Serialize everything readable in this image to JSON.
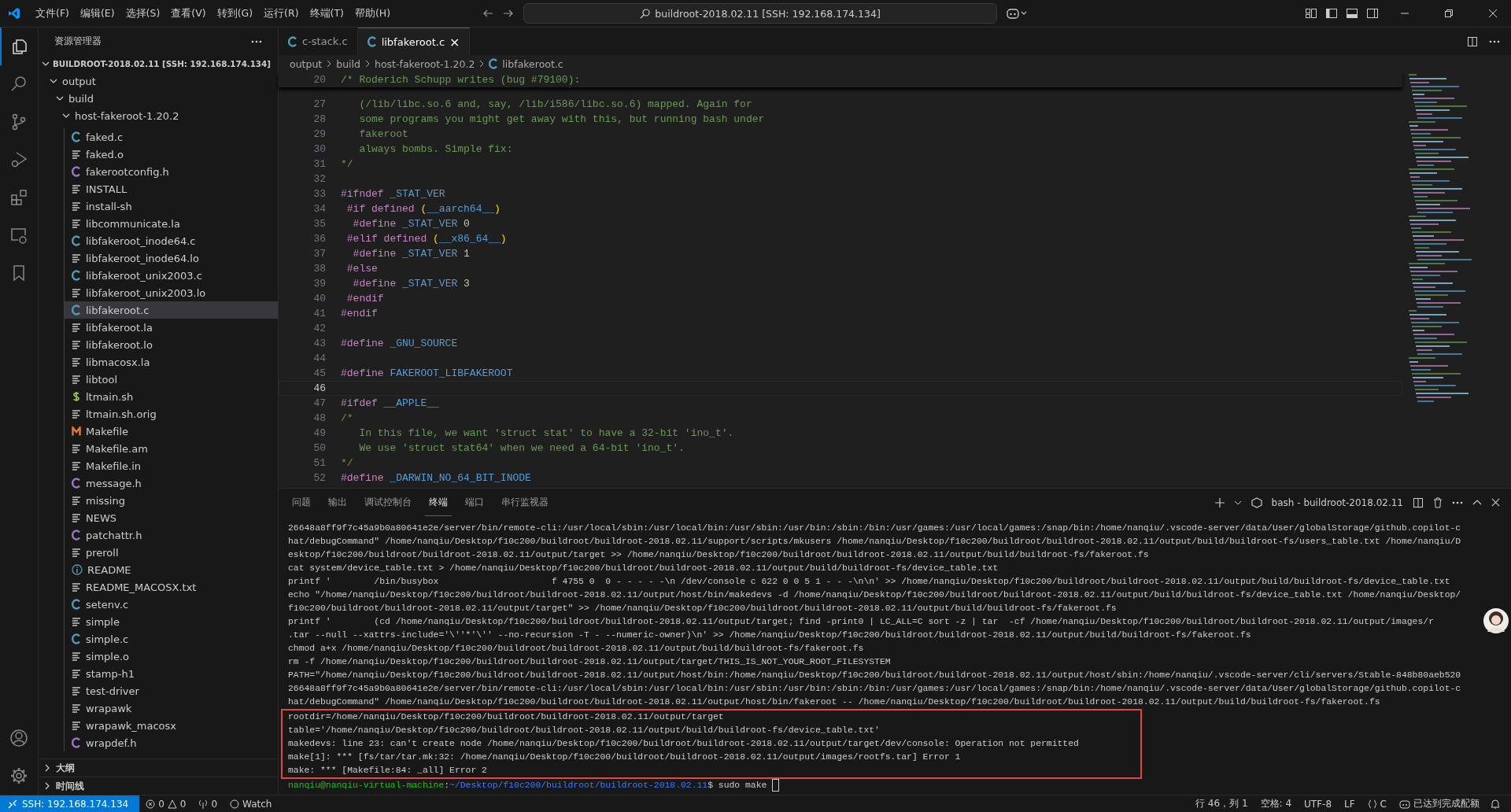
{
  "title_bar": {
    "menus": [
      "文件(F)",
      "编辑(E)",
      "选择(S)",
      "查看(V)",
      "转到(G)",
      "运行(R)",
      "终端(T)",
      "帮助(H)"
    ],
    "command_center": "buildroot-2018.02.11 [SSH: 192.168.174.134]"
  },
  "sidebar": {
    "title": "资源管理器",
    "root": "BUILDROOT-2018.02.11 [SSH: 192.168.174.134]",
    "folders": [
      {
        "label": "output",
        "expanded": true
      },
      {
        "label": "build",
        "expanded": true
      },
      {
        "label": "host-fakeroot-1.20.2",
        "expanded": true
      }
    ],
    "files": [
      {
        "name": "faked.c",
        "kind": "c",
        "selected": false
      },
      {
        "name": "faked.o",
        "kind": "text",
        "selected": false
      },
      {
        "name": "fakerootconfig.h",
        "kind": "h",
        "selected": false
      },
      {
        "name": "INSTALL",
        "kind": "text",
        "selected": false
      },
      {
        "name": "install-sh",
        "kind": "text",
        "selected": false
      },
      {
        "name": "libcommunicate.la",
        "kind": "text",
        "selected": false
      },
      {
        "name": "libfakeroot_inode64.c",
        "kind": "c",
        "selected": false
      },
      {
        "name": "libfakeroot_inode64.lo",
        "kind": "text",
        "selected": false
      },
      {
        "name": "libfakeroot_unix2003.c",
        "kind": "c",
        "selected": false
      },
      {
        "name": "libfakeroot_unix2003.lo",
        "kind": "text",
        "selected": false
      },
      {
        "name": "libfakeroot.c",
        "kind": "c",
        "selected": true
      },
      {
        "name": "libfakeroot.la",
        "kind": "text",
        "selected": false
      },
      {
        "name": "libfakeroot.lo",
        "kind": "text",
        "selected": false
      },
      {
        "name": "libmacosx.la",
        "kind": "text",
        "selected": false
      },
      {
        "name": "libtool",
        "kind": "text",
        "selected": false
      },
      {
        "name": "ltmain.sh",
        "kind": "shell",
        "selected": false
      },
      {
        "name": "ltmain.sh.orig",
        "kind": "text",
        "selected": false
      },
      {
        "name": "Makefile",
        "kind": "make",
        "selected": false
      },
      {
        "name": "Makefile.am",
        "kind": "text",
        "selected": false
      },
      {
        "name": "Makefile.in",
        "kind": "text",
        "selected": false
      },
      {
        "name": "message.h",
        "kind": "h",
        "selected": false
      },
      {
        "name": "missing",
        "kind": "text",
        "selected": false
      },
      {
        "name": "NEWS",
        "kind": "text",
        "selected": false
      },
      {
        "name": "patchattr.h",
        "kind": "h",
        "selected": false
      },
      {
        "name": "preroll",
        "kind": "text",
        "selected": false
      },
      {
        "name": "README",
        "kind": "info",
        "selected": false
      },
      {
        "name": "README_MACOSX.txt",
        "kind": "text",
        "selected": false
      },
      {
        "name": "setenv.c",
        "kind": "c",
        "selected": false
      },
      {
        "name": "simple",
        "kind": "text",
        "selected": false
      },
      {
        "name": "simple.c",
        "kind": "c",
        "selected": false
      },
      {
        "name": "simple.o",
        "kind": "text",
        "selected": false
      },
      {
        "name": "stamp-h1",
        "kind": "text",
        "selected": false
      },
      {
        "name": "test-driver",
        "kind": "text",
        "selected": false
      },
      {
        "name": "wrapawk",
        "kind": "text",
        "selected": false
      },
      {
        "name": "wrapawk_macosx",
        "kind": "text",
        "selected": false
      },
      {
        "name": "wrapdef.h",
        "kind": "h",
        "selected": false
      }
    ],
    "sections": [
      {
        "label": "大纲",
        "expanded": false
      },
      {
        "label": "时间线",
        "expanded": false
      }
    ]
  },
  "tabs": [
    {
      "label": "c-stack.c",
      "kind": "c",
      "selected": false
    },
    {
      "label": "libfakeroot.c",
      "kind": "c",
      "selected": true
    }
  ],
  "close_glyph": "×",
  "breadcrumbs": [
    {
      "label": "output",
      "kind": "folder"
    },
    {
      "label": "build",
      "kind": "folder"
    },
    {
      "label": "host-fakeroot-1.20.2",
      "kind": "folder"
    },
    {
      "label": "libfakeroot.c",
      "kind": "c"
    }
  ],
  "sticky_line": {
    "num": "20",
    "tokens": [
      {
        "kind": "comment",
        "text": "/* Roderich Schupp writes (bug #79100):"
      }
    ]
  },
  "code": [
    {
      "num": "27",
      "current": false,
      "tokens": [
        {
          "kind": "comment",
          "text": "   (/lib/libc.so.6 and, say, /lib/i586/libc.so.6) mapped. Again for"
        }
      ]
    },
    {
      "num": "28",
      "current": false,
      "tokens": [
        {
          "kind": "comment",
          "text": "   some programs you might get away with this, but running bash under"
        }
      ]
    },
    {
      "num": "29",
      "current": false,
      "tokens": [
        {
          "kind": "comment",
          "text": "   fakeroot"
        }
      ]
    },
    {
      "num": "30",
      "current": false,
      "tokens": [
        {
          "kind": "comment",
          "text": "   always bombs. Simple fix:"
        }
      ]
    },
    {
      "num": "31",
      "current": false,
      "tokens": [
        {
          "kind": "comment",
          "text": "*/"
        }
      ]
    },
    {
      "num": "32",
      "current": false
    },
    {
      "num": "33",
      "current": false,
      "tokens": [
        {
          "kind": "directive",
          "text": "#ifndef"
        },
        {
          "kind": "macro",
          "text": " _STAT_VER"
        }
      ]
    },
    {
      "num": "34",
      "current": false,
      "tokens": [
        {
          "kind": "directive",
          "text": " #if defined "
        },
        {
          "kind": "paren",
          "text": "("
        },
        {
          "kind": "macro",
          "text": "__aarch64__"
        },
        {
          "kind": "paren",
          "text": ")"
        }
      ]
    },
    {
      "num": "35",
      "current": false,
      "tokens": [
        {
          "kind": "directive",
          "text": "  #define"
        },
        {
          "kind": "macro",
          "text": " _STAT_VER"
        },
        {
          "kind": "number",
          "text": " 0"
        }
      ]
    },
    {
      "num": "36",
      "current": false,
      "tokens": [
        {
          "kind": "directive",
          "text": " #elif defined "
        },
        {
          "kind": "paren",
          "text": "("
        },
        {
          "kind": "macro",
          "text": "__x86_64__"
        },
        {
          "kind": "paren",
          "text": ")"
        }
      ]
    },
    {
      "num": "37",
      "current": false,
      "tokens": [
        {
          "kind": "directive",
          "text": "  #define"
        },
        {
          "kind": "macro",
          "text": " _STAT_VER"
        },
        {
          "kind": "number",
          "text": " 1"
        }
      ]
    },
    {
      "num": "38",
      "current": false,
      "tokens": [
        {
          "kind": "directive",
          "text": " #else"
        }
      ]
    },
    {
      "num": "39",
      "current": false,
      "tokens": [
        {
          "kind": "directive",
          "text": "  #define"
        },
        {
          "kind": "macro",
          "text": " _STAT_VER"
        },
        {
          "kind": "number",
          "text": " 3"
        }
      ]
    },
    {
      "num": "40",
      "current": false,
      "tokens": [
        {
          "kind": "directive",
          "text": " #endif"
        }
      ]
    },
    {
      "num": "41",
      "current": false,
      "tokens": [
        {
          "kind": "directive",
          "text": "#endif"
        }
      ]
    },
    {
      "num": "42",
      "current": false
    },
    {
      "num": "43",
      "current": false,
      "tokens": [
        {
          "kind": "directive",
          "text": "#define"
        },
        {
          "kind": "macro",
          "text": " _GNU_SOURCE"
        }
      ]
    },
    {
      "num": "44",
      "current": false
    },
    {
      "num": "45",
      "current": false,
      "tokens": [
        {
          "kind": "directive",
          "text": "#define"
        },
        {
          "kind": "macro",
          "text": " FAKEROOT_LIBFAKEROOT"
        }
      ]
    },
    {
      "num": "46",
      "current": true
    },
    {
      "num": "47",
      "current": false,
      "tokens": [
        {
          "kind": "directive",
          "text": "#ifdef"
        },
        {
          "kind": "macro",
          "text": " __APPLE__"
        }
      ]
    },
    {
      "num": "48",
      "current": false,
      "tokens": [
        {
          "kind": "comment",
          "text": "/*"
        }
      ]
    },
    {
      "num": "49",
      "current": false,
      "tokens": [
        {
          "kind": "comment",
          "text": "   In this file, we want 'struct stat' to have a 32-bit 'ino_t'."
        }
      ]
    },
    {
      "num": "50",
      "current": false,
      "tokens": [
        {
          "kind": "comment",
          "text": "   We use 'struct stat64' when we need a 64-bit 'ino_t'."
        }
      ]
    },
    {
      "num": "51",
      "current": false,
      "tokens": [
        {
          "kind": "comment",
          "text": "*/"
        }
      ]
    },
    {
      "num": "52",
      "current": false,
      "tokens": [
        {
          "kind": "directive",
          "text": "#define"
        },
        {
          "kind": "macro",
          "text": " _DARWIN_NO_64_BIT_INODE"
        }
      ]
    }
  ],
  "panel": {
    "tabs": [
      {
        "label": "问题",
        "selected": false
      },
      {
        "label": "输出",
        "selected": false
      },
      {
        "label": "调试控制台",
        "selected": false
      },
      {
        "label": "终端",
        "selected": true
      },
      {
        "label": "端口",
        "selected": false
      },
      {
        "label": "串行监视器",
        "selected": false
      }
    ],
    "terminal_name": "bash - buildroot-2018.02.11"
  },
  "terminal": {
    "lines": [
      "26648a8ff9f7c45a9b0a80641e2e/server/bin/remote-cli:/usr/local/sbin:/usr/local/bin:/usr/sbin:/usr/bin:/sbin:/bin:/usr/games:/usr/local/games:/snap/bin:/home/nanqiu/.vscode-server/data/User/globalStorage/github.copilot-c",
      "hat/debugCommand\" /home/nanqiu/Desktop/f10c200/buildroot/buildroot-2018.02.11/support/scripts/mkusers /home/nanqiu/Desktop/f10c200/buildroot/buildroot-2018.02.11/output/build/buildroot-fs/users_table.txt /home/nanqiu/D",
      "esktop/f10c200/buildroot/buildroot-2018.02.11/output/target >> /home/nanqiu/Desktop/f10c200/buildroot/buildroot-2018.02.11/output/build/buildroot-fs/fakeroot.fs",
      "cat system/device_table.txt > /home/nanqiu/Desktop/f10c200/buildroot/buildroot-2018.02.11/output/build/buildroot-fs/device_table.txt",
      "printf '        /bin/busybox                     f 4755 0  0 - - - - -\\n /dev/console c 622 0 0 5 1 - - -\\n\\n' >> /home/nanqiu/Desktop/f10c200/buildroot/buildroot-2018.02.11/output/build/buildroot-fs/device_table.txt",
      "echo \"/home/nanqiu/Desktop/f10c200/buildroot/buildroot-2018.02.11/output/host/bin/makedevs -d /home/nanqiu/Desktop/f10c200/buildroot/buildroot-2018.02.11/output/build/buildroot-fs/device_table.txt /home/nanqiu/Desktop/",
      "f10c200/buildroot/buildroot-2018.02.11/output/target\" >> /home/nanqiu/Desktop/f10c200/buildroot/buildroot-2018.02.11/output/build/buildroot-fs/fakeroot.fs",
      "printf '        (cd /home/nanqiu/Desktop/f10c200/buildroot/buildroot-2018.02.11/output/target; find -print0 | LC_ALL=C sort -z | tar  -cf /home/nanqiu/Desktop/f10c200/buildroot/buildroot-2018.02.11/output/images/r",
      ".tar --null --xattrs-include='\\''*'\\'' --no-recursion -T - --numeric-owner)\\n' >> /home/nanqiu/Desktop/f10c200/buildroot/buildroot-2018.02.11/output/build/buildroot-fs/fakeroot.fs",
      "chmod a+x /home/nanqiu/Desktop/f10c200/buildroot/buildroot-2018.02.11/output/build/buildroot-fs/fakeroot.fs",
      "rm -f /home/nanqiu/Desktop/f10c200/buildroot/buildroot-2018.02.11/output/target/THIS_IS_NOT_YOUR_ROOT_FILESYSTEM",
      "PATH=\"/home/nanqiu/Desktop/f10c200/buildroot/buildroot-2018.02.11/output/host/bin:/home/nanqiu/Desktop/f10c200/buildroot/buildroot-2018.02.11/output/host/sbin:/home/nanqiu/.vscode-server/cli/servers/Stable-848b80aeb520",
      "26648a8ff9f7c45a9b0a80641e2e/server/bin/remote-cli:/usr/local/sbin:/usr/local/bin:/usr/sbin:/usr/bin:/sbin:/bin:/usr/games:/usr/local/games:/snap/bin:/home/nanqiu/.vscode-server/data/User/globalStorage/github.copilot-c",
      "hat/debugCommand\" /home/nanqiu/Desktop/f10c200/buildroot/buildroot-2018.02.11/output/host/bin/fakeroot -- /home/nanqiu/Desktop/f10c200/buildroot/buildroot-2018.02.11/output/build/buildroot-fs/fakeroot.fs"
    ],
    "highlighted_lines": [
      "rootdir=/home/nanqiu/Desktop/f10c200/buildroot/buildroot-2018.02.11/output/target",
      "table='/home/nanqiu/Desktop/f10c200/buildroot/buildroot-2018.02.11/output/build/buildroot-fs/device_table.txt'",
      "makedevs: line 23: can't create node /home/nanqiu/Desktop/f10c200/buildroot/buildroot-2018.02.11/output/target/dev/console: Operation not permitted",
      "make[1]: *** [fs/tar/tar.mk:32: /home/nanqiu/Desktop/f10c200/buildroot/buildroot-2018.02.11/output/images/rootfs.tar] Error 1",
      "make: *** [Makefile:84: _all] Error 2"
    ],
    "prompt": {
      "user": "nanqiu@nanqiu-virtual-machine",
      "separator": ":",
      "path": "~/Desktop/f10c200/buildroot/buildroot-2018.02.11",
      "command": "$ sudo make"
    }
  },
  "status_bar": {
    "remote": "SSH: 192.168.174.134",
    "errors": "0",
    "warnings": "0",
    "ports": "0",
    "watch": "Watch",
    "position": "行 46，列 1",
    "indent": "空格: 4",
    "encoding": "UTF-8",
    "eol": "LF",
    "language": "C",
    "quota": "已达到完成配额"
  }
}
